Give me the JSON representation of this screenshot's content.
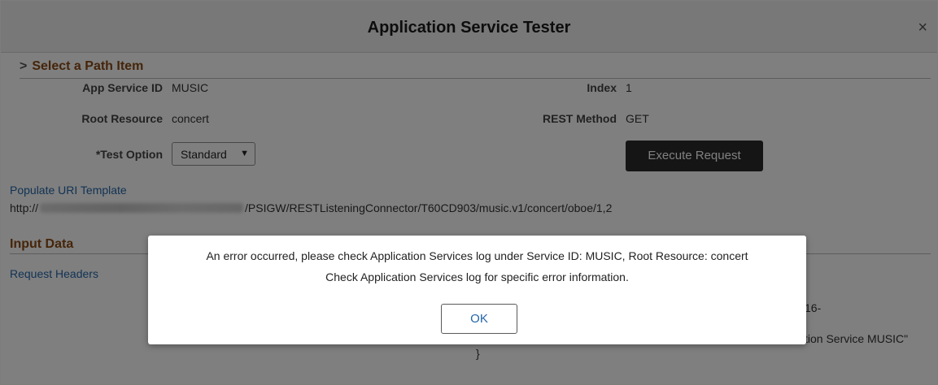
{
  "window": {
    "title": "Application Service Tester",
    "close_glyph": "×"
  },
  "path_section": {
    "heading": "Select a Path Item",
    "app_service_id": {
      "label": "App Service ID",
      "value": "MUSIC"
    },
    "index": {
      "label": "Index",
      "value": "1"
    },
    "root_resource": {
      "label": "Root Resource",
      "value": "concert"
    },
    "rest_method": {
      "label": "REST Method",
      "value": "GET"
    },
    "test_option": {
      "label": "*Test Option",
      "value": "Standard"
    },
    "execute_label": "Execute Request",
    "populate_link": "Populate URI Template",
    "url_prefix": "http://",
    "url_suffix": "/PSIGW/RESTListeningConnector/T60CD903/music.v1/concert/oboe/1,2"
  },
  "input_section": {
    "heading": "Input Data",
    "request_headers_link": "Request Headers",
    "response_fragment_1": "16-",
    "response_fragment_2": "tion Service MUSIC\"",
    "response_brace": "}"
  },
  "dialog": {
    "line1": "An error occurred, please check Application Services log under Service ID: MUSIC, Root Resource: concert",
    "line2": "Check Application Services log for specific error information.",
    "ok_label": "OK"
  },
  "colors": {
    "section_heading": "#8a4a14",
    "link": "#2466a8",
    "execute_button": "#2b2b2b",
    "overlay": "rgba(0,0,0,0.5)"
  }
}
